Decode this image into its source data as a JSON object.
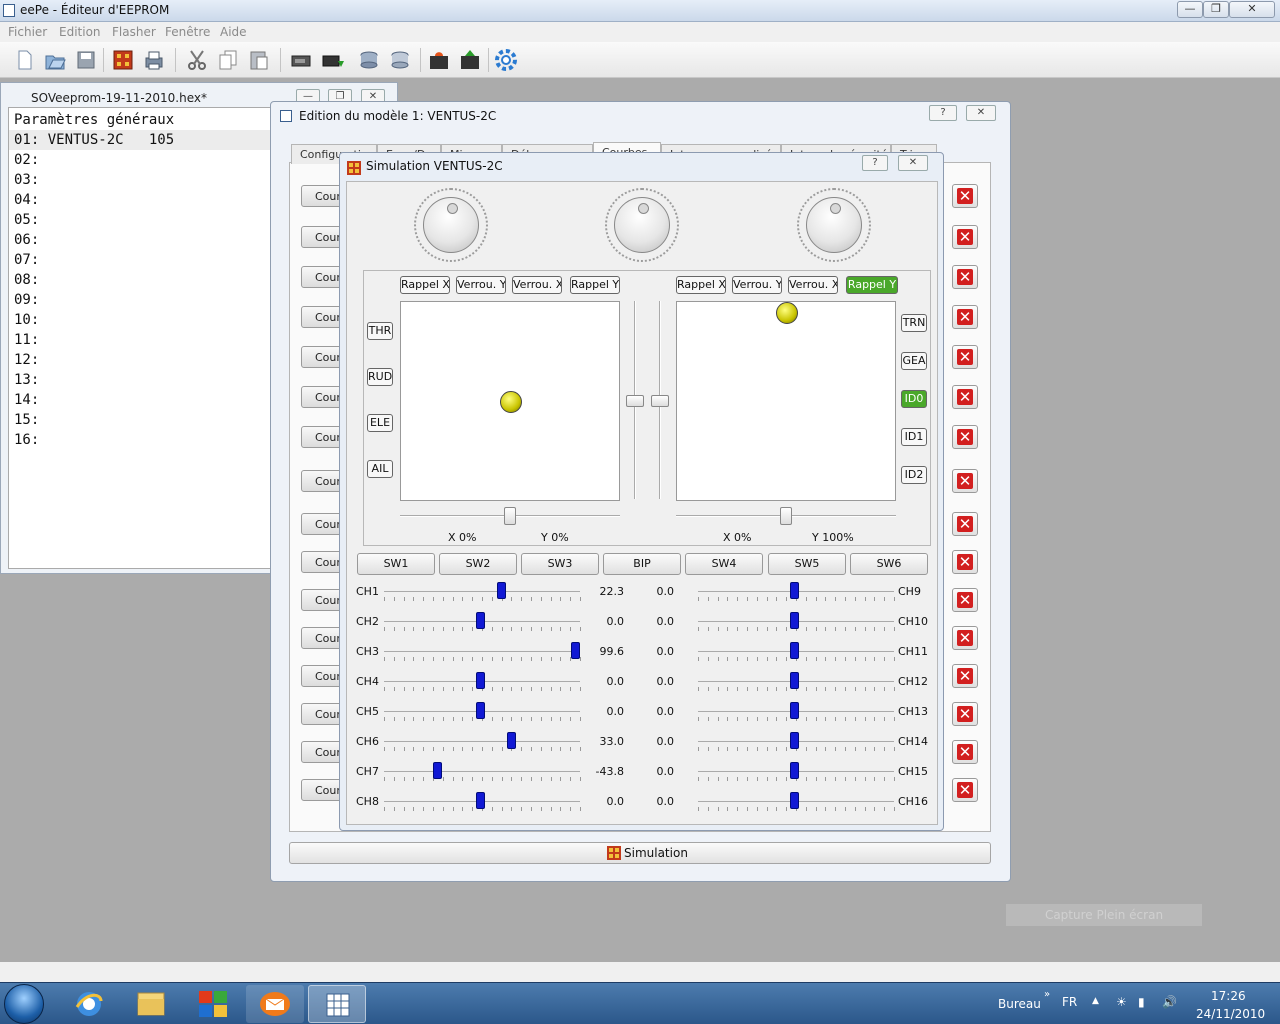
{
  "app": {
    "title": "eePe - Éditeur d'EEPROM"
  },
  "menu": [
    "Fichier",
    "Edition",
    "Flasher",
    "Fenêtre",
    "Aide"
  ],
  "toolbar_icons": [
    "new-file",
    "open-file",
    "save",
    "chip-programmer",
    "print",
    "cut",
    "copy",
    "paste",
    "read-from-radio",
    "write-to-radio",
    "read-eeprom",
    "write-eeprom",
    "burn-read",
    "burn-write",
    "settings"
  ],
  "eeprom": {
    "title": "SOVeeprom-19-11-2010.hex*",
    "rows": [
      "Paramètres généraux",
      "01: VENTUS-2C   105",
      "02:",
      "03:",
      "04:",
      "05:",
      "06:",
      "07:",
      "08:",
      "09:",
      "10:",
      "11:",
      "12:",
      "13:",
      "14:",
      "15:",
      "16:"
    ]
  },
  "model": {
    "title": "Edition du modèle 1: VENTUS-2C",
    "help": "?",
    "tabs": [
      "Configuration",
      "Expo/Dr",
      "Mixeurs",
      "Déb.",
      "Courbes",
      "Inter. personnalisés",
      "Interr. de sécurité",
      "Trim"
    ],
    "curve_buttons": [
      "Courb",
      "Courb",
      "Courb",
      "Courb",
      "Courb",
      "Courb",
      "Courb",
      "Courb",
      "Courb",
      "Courb",
      "Courb",
      "Courb",
      "Courb",
      "Courb",
      "Courb",
      "Courb"
    ],
    "delete_label": "✕",
    "sim_button": "Simulation"
  },
  "sim": {
    "title": "Simulation VENTUS-2C",
    "help": "?",
    "left_toggles": [
      "Rappel X",
      "Verrou. Y",
      "Verrou. X",
      "Rappel Y"
    ],
    "right_toggles": [
      "Rappel X",
      "Verrou. Y",
      "Verrou. X",
      "Rappel Y"
    ],
    "left_side": [
      "THR",
      "RUD",
      "ELE",
      "AIL"
    ],
    "right_side": [
      "TRN",
      "GEA",
      "ID0",
      "ID1",
      "ID2"
    ],
    "left_readout": {
      "x": "X  0%",
      "y": "Y  0%"
    },
    "right_readout": {
      "x": "X  0%",
      "y": "Y  100%"
    },
    "switches": [
      "SW1",
      "SW2",
      "SW3",
      "BIP",
      "SW4",
      "SW5",
      "SW6"
    ],
    "channels_left": [
      {
        "label": "CH1",
        "value": "22.3",
        "pos": 0.61
      },
      {
        "label": "CH2",
        "value": "0.0",
        "pos": 0.5
      },
      {
        "label": "CH3",
        "value": "99.6",
        "pos": 1.0
      },
      {
        "label": "CH4",
        "value": "0.0",
        "pos": 0.5
      },
      {
        "label": "CH5",
        "value": "0.0",
        "pos": 0.5
      },
      {
        "label": "CH6",
        "value": "33.0",
        "pos": 0.665
      },
      {
        "label": "CH7",
        "value": "-43.8",
        "pos": 0.28
      },
      {
        "label": "CH8",
        "value": "0.0",
        "pos": 0.5
      }
    ],
    "channels_right": [
      {
        "label": "CH9",
        "value": "0.0",
        "pos": 0.5
      },
      {
        "label": "CH10",
        "value": "0.0",
        "pos": 0.5
      },
      {
        "label": "CH11",
        "value": "0.0",
        "pos": 0.5
      },
      {
        "label": "CH12",
        "value": "0.0",
        "pos": 0.5
      },
      {
        "label": "CH13",
        "value": "0.0",
        "pos": 0.5
      },
      {
        "label": "CH14",
        "value": "0.0",
        "pos": 0.5
      },
      {
        "label": "CH15",
        "value": "0.0",
        "pos": 0.5
      },
      {
        "label": "CH16",
        "value": "0.0",
        "pos": 0.5
      }
    ]
  },
  "capture_hint": "Capture Plein écran",
  "taskbar": {
    "desktop": "Bureau",
    "lang": "FR",
    "time": "17:26",
    "date": "24/11/2010"
  },
  "colors": {
    "active_green": "#4aa82a",
    "channel_knob": "#1119d4",
    "delete_red": "#d21f1f"
  }
}
